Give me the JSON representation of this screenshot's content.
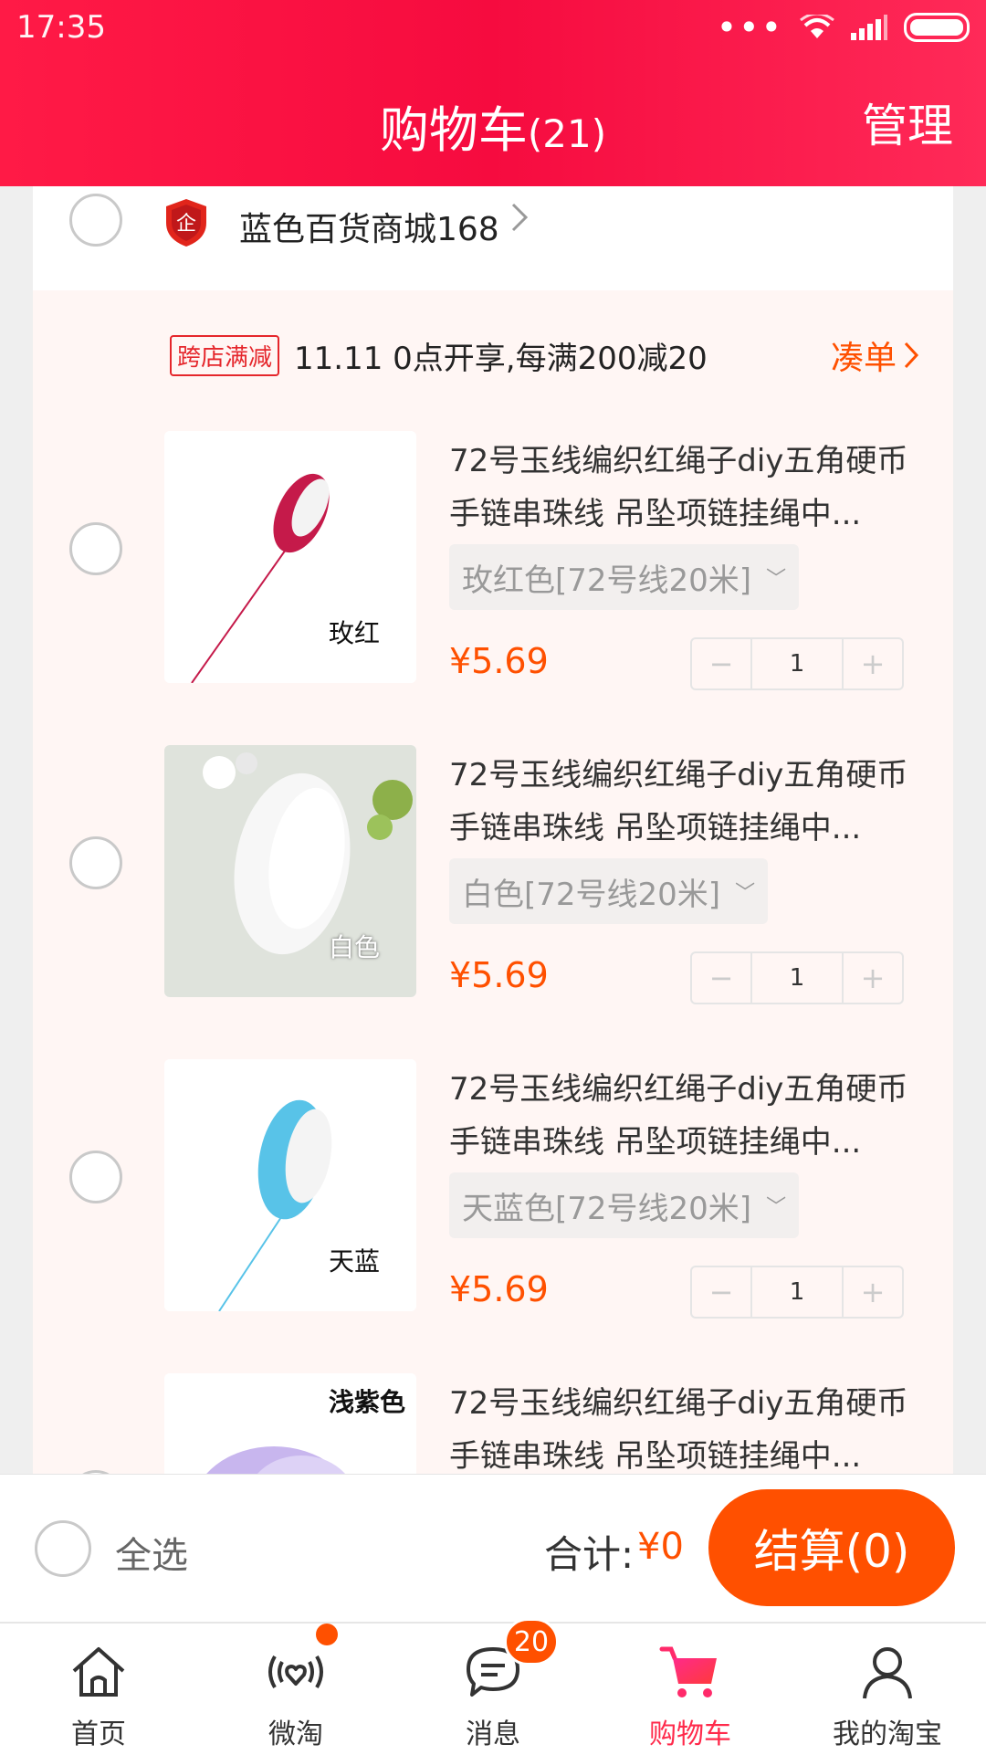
{
  "status": {
    "time": "17:35"
  },
  "header": {
    "title": "购物车",
    "count": "(21)",
    "manage": "管理"
  },
  "store": {
    "name": "蓝色百货商城168"
  },
  "promo": {
    "tag": "跨店满减",
    "text": "11.11 0点开享,每满200减20",
    "link": "凑单"
  },
  "items": [
    {
      "title": "72号玉线编织红绳子diy五角硬币手链串珠线 吊坠项链挂绳中...",
      "sku": "玫红色[72号线20米]",
      "price": "¥5.69",
      "qty": "1",
      "thumb_label": "玫红",
      "thumb_color": "#c51a4a"
    },
    {
      "title": "72号玉线编织红绳子diy五角硬币手链串珠线 吊坠项链挂绳中...",
      "sku": "白色[72号线20米]",
      "price": "¥5.69",
      "qty": "1",
      "thumb_label": "白色",
      "thumb_color": "#f4f4f4"
    },
    {
      "title": "72号玉线编织红绳子diy五角硬币手链串珠线 吊坠项链挂绳中...",
      "sku": "天蓝色[72号线20米]",
      "price": "¥5.69",
      "qty": "1",
      "thumb_label": "天蓝",
      "thumb_color": "#58c3e8"
    },
    {
      "title": "72号玉线编织红绳子diy五角硬币手链串珠线 吊坠项链挂绳中...",
      "thumb_label": "浅紫色",
      "thumb_color": "#c8b6ee"
    }
  ],
  "summary": {
    "select_all": "全选",
    "total_label": "合计:",
    "total_value": "¥0",
    "checkout": "结算(0)"
  },
  "tabs": [
    {
      "label": "首页",
      "icon": "home-icon"
    },
    {
      "label": "微淘",
      "icon": "weitao-icon"
    },
    {
      "label": "消息",
      "icon": "message-icon",
      "badge": "20"
    },
    {
      "label": "购物车",
      "icon": "cart-icon"
    },
    {
      "label": "我的淘宝",
      "icon": "profile-icon"
    }
  ],
  "colors": {
    "brand": "#ff1a46",
    "price": "#ff5000",
    "active_tab": "#ff2a4b"
  }
}
